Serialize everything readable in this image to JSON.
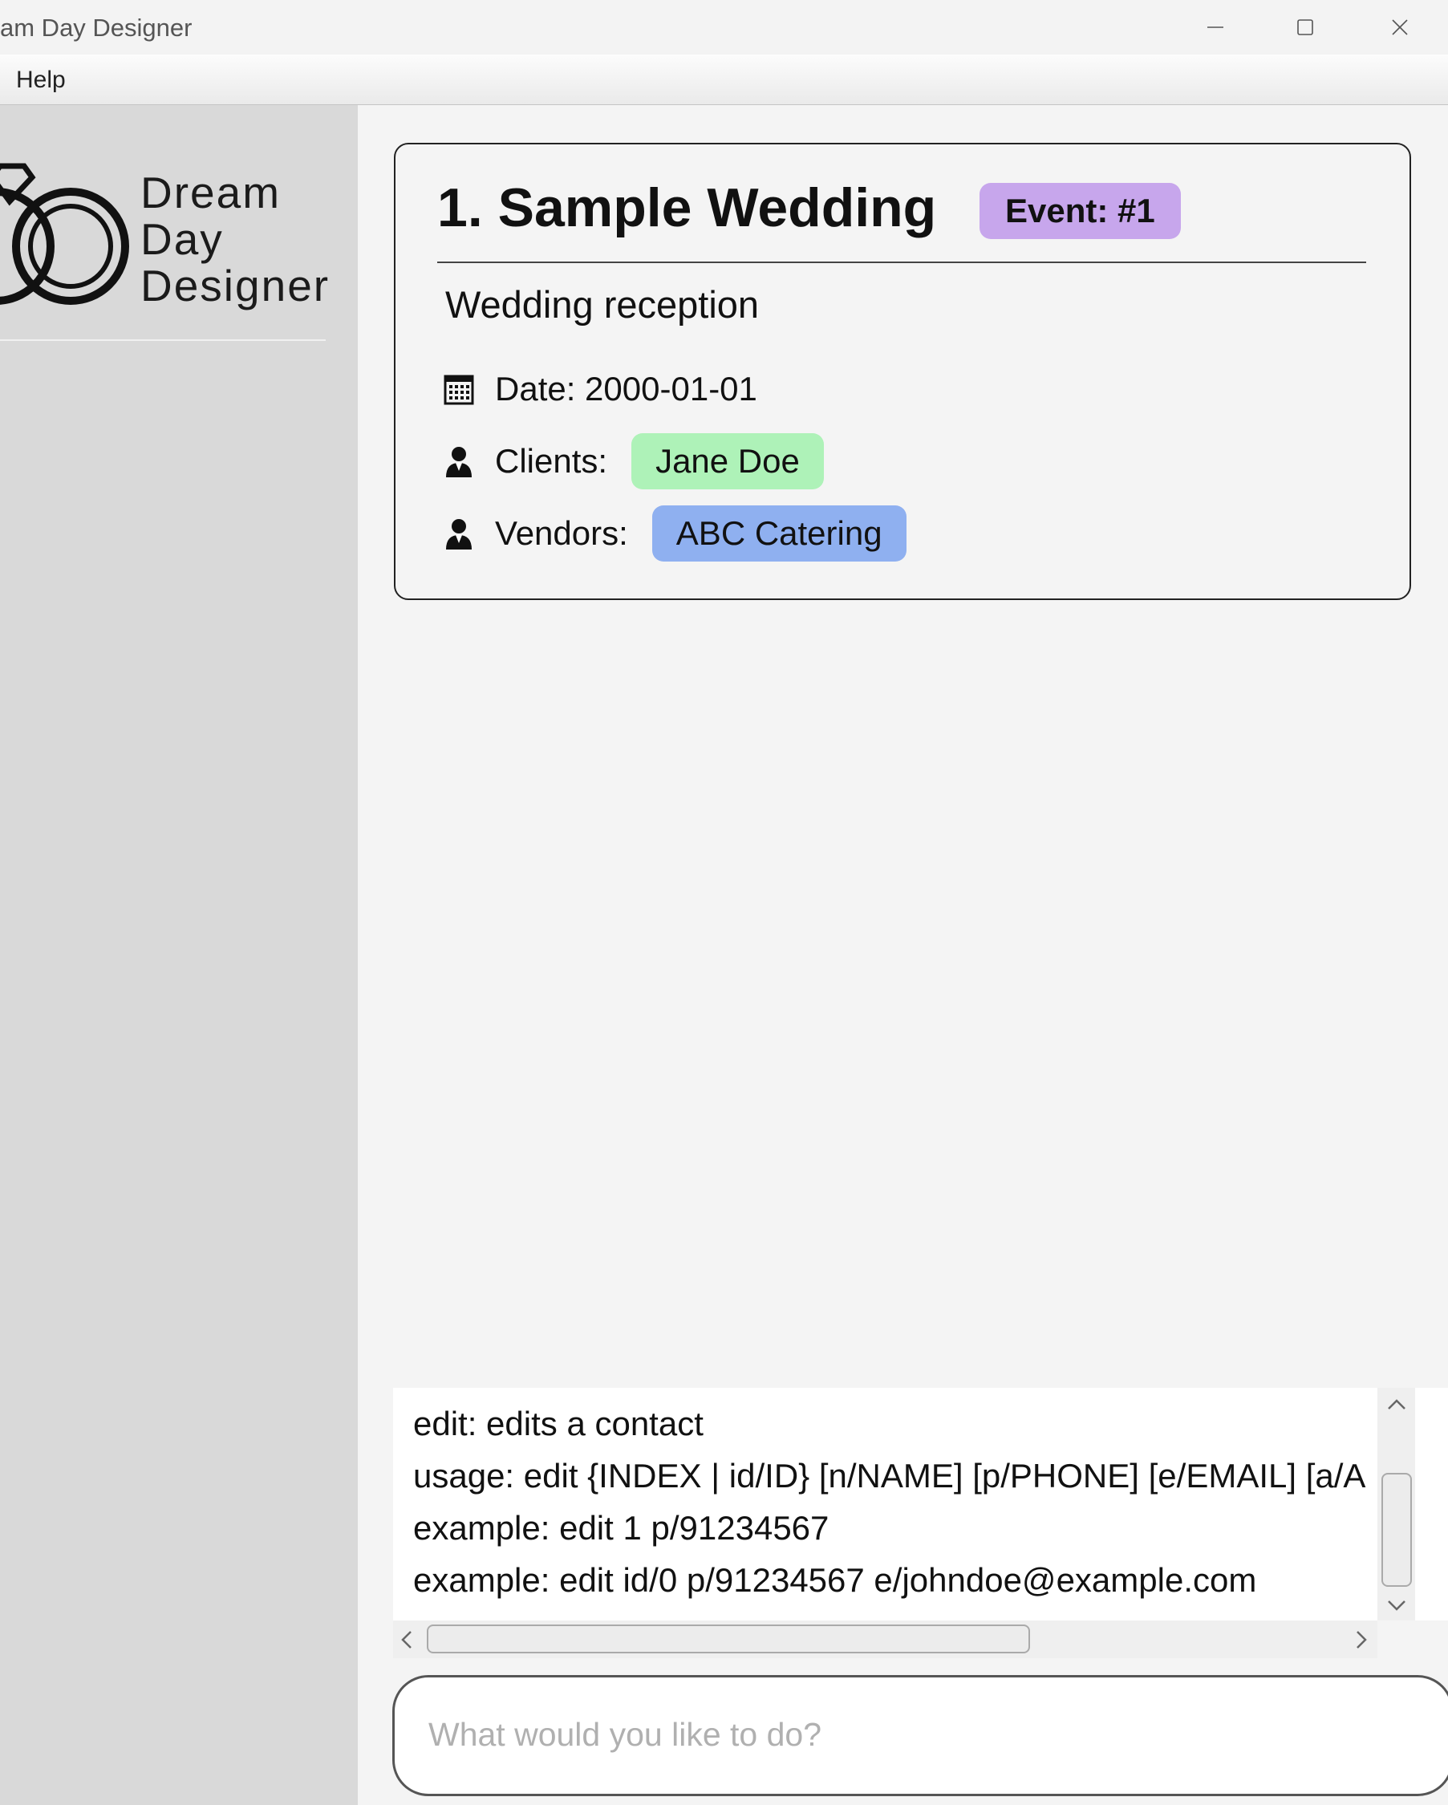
{
  "window": {
    "title": "am Day Designer"
  },
  "menu": {
    "help": "Help"
  },
  "sidebar": {
    "logo_lines": [
      "Dream",
      "Day",
      "Designer"
    ]
  },
  "event": {
    "title": "1. Sample Wedding",
    "badge": "Event: #1",
    "description": "Wedding reception",
    "date_label": "Date: 2000-01-01",
    "clients_label": "Clients:",
    "clients": [
      "Jane Doe"
    ],
    "vendors_label": "Vendors:",
    "vendors": [
      "ABC Catering"
    ],
    "colors": {
      "badge": "#c7a6ec",
      "client_chip": "#aef2b8",
      "vendor_chip": "#8fb0f0"
    }
  },
  "result": {
    "lines": [
      "edit: edits a contact",
      "usage: edit {INDEX | id/ID} [n/NAME] [p/PHONE] [e/EMAIL] [a/A",
      "example: edit 1 p/91234567",
      "example: edit id/0 p/91234567 e/johndoe@example.com"
    ]
  },
  "command": {
    "placeholder": "What would you like to do?",
    "value": ""
  },
  "icons": {
    "logo": "wedding-rings-icon",
    "date": "calendar-icon",
    "clients": "person-icon",
    "vendors": "person-icon",
    "minimize": "minimize-icon",
    "maximize": "maximize-icon",
    "close": "close-icon"
  }
}
